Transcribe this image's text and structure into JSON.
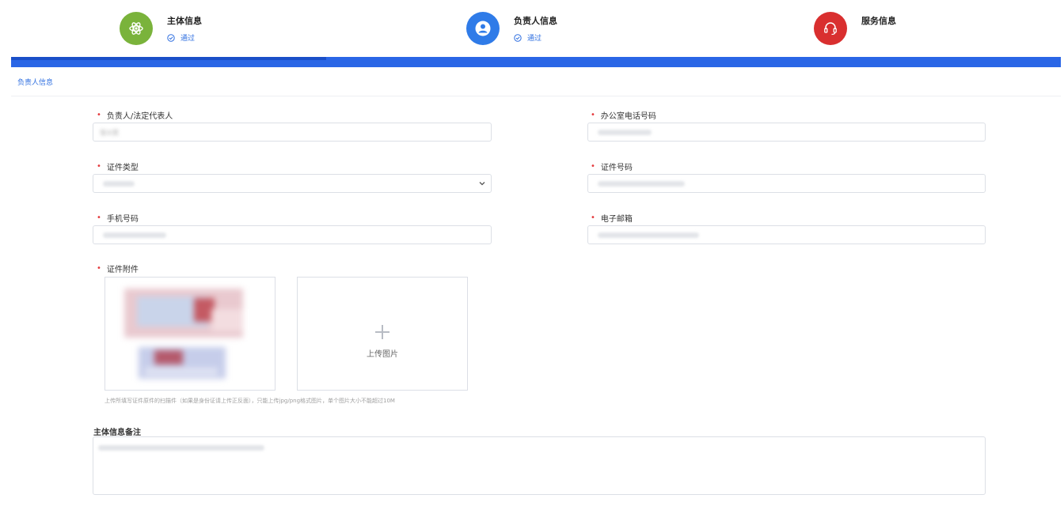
{
  "colors": {
    "accent": "#2f6fe0",
    "progress": "#2a66e6",
    "step1": "#7ab33b",
    "step2": "#2f7be8",
    "step3": "#d92f2f",
    "required": "#e4393c"
  },
  "progress_fraction": 0.3,
  "steps": [
    {
      "title": "主体信息",
      "status": "通过",
      "icon": "atom-icon"
    },
    {
      "title": "负责人信息",
      "status": "通过",
      "icon": "user-icon"
    },
    {
      "title": "服务信息",
      "status": "",
      "icon": "headset-icon"
    }
  ],
  "section": {
    "title": "负责人信息"
  },
  "form": {
    "legal_rep": {
      "label": "负责人/法定代表人",
      "value": "张X资"
    },
    "office_phone": {
      "label": "办公室电话号码"
    },
    "id_type": {
      "label": "证件类型"
    },
    "id_number": {
      "label": "证件号码"
    },
    "mobile": {
      "label": "手机号码"
    },
    "email": {
      "label": "电子邮箱"
    },
    "attachment": {
      "label": "证件附件",
      "upload_label": "上传图片",
      "hint": "上传所填写证件原件的扫描件（如果是身份证请上传正反面），只能上传jpg/png格式图片，单个图片大小不能超过10M"
    },
    "remark": {
      "label": "主体信息备注"
    }
  }
}
